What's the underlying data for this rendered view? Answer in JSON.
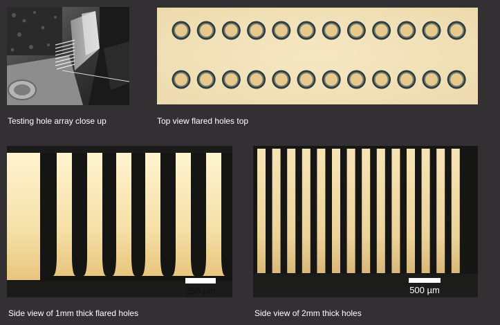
{
  "panels": {
    "closeup": {
      "caption": "Testing hole array close up"
    },
    "topview": {
      "caption": "Top view flared holes top",
      "rows": 2,
      "holes_per_row": 12
    },
    "side1mm": {
      "caption": "Side view of 1mm thick flared holes",
      "scale_label": "250 µm",
      "gaps": 6
    },
    "side2mm": {
      "caption": "Side view of 2mm thick holes",
      "scale_label": "500 µm",
      "gaps": 14
    }
  },
  "colors": {
    "background": "#323033",
    "light": "#f2e4ba",
    "dark": "#151513",
    "caption": "#ffffff"
  }
}
